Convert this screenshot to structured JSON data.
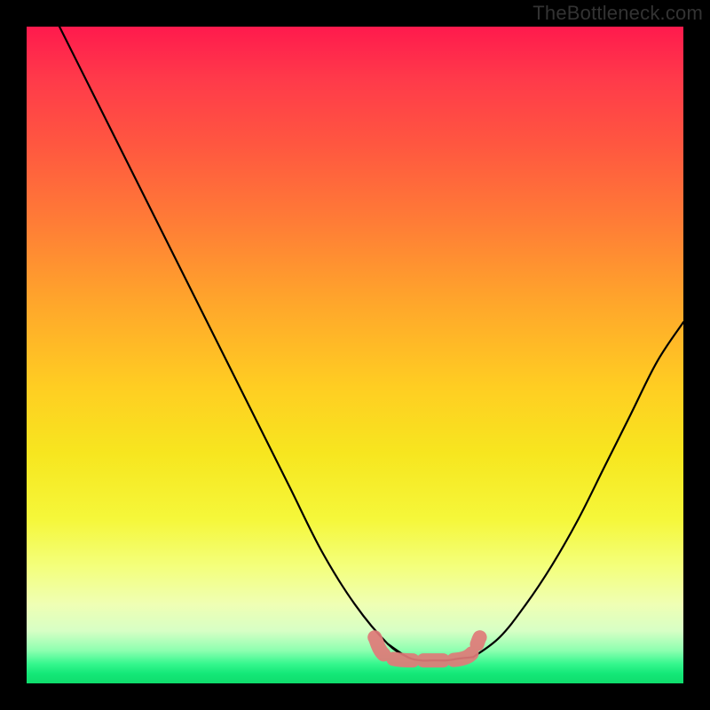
{
  "watermark": "TheBottleneck.com",
  "colors": {
    "top": "#ff1a4d",
    "mid": "#ffe433",
    "bottom": "#14e878",
    "curve": "#000000",
    "highlight": "#e07a78",
    "frame": "#000000"
  },
  "chart_data": {
    "type": "line",
    "title": "",
    "xlabel": "",
    "ylabel": "",
    "xlim": [
      0,
      100
    ],
    "ylim": [
      0,
      100
    ],
    "grid": false,
    "legend": false,
    "background_gradient": "vertical red-to-green (high=bad, low=good)",
    "description": "Bottleneck curve: one steep branch descends from top-left, a shallower branch rises toward top-right; they meet in a flat minimum near x≈55–68. The flat bottom is highlighted with a dashed salmon band.",
    "series": [
      {
        "name": "left-branch",
        "x": [
          5,
          10,
          15,
          20,
          25,
          30,
          35,
          40,
          45,
          50,
          55,
          58
        ],
        "y": [
          100,
          90,
          80,
          70,
          60,
          50,
          40,
          30,
          20,
          12,
          6,
          4
        ]
      },
      {
        "name": "right-branch",
        "x": [
          68,
          72,
          76,
          80,
          84,
          88,
          92,
          96,
          100
        ],
        "y": [
          4,
          7,
          12,
          18,
          25,
          33,
          41,
          49,
          55
        ]
      },
      {
        "name": "optimum-flat",
        "x": [
          55,
          58,
          60,
          62,
          64,
          66,
          68
        ],
        "y": [
          6,
          4,
          3.5,
          3.5,
          3.5,
          3.8,
          4
        ]
      }
    ],
    "annotations": [
      {
        "name": "optimal-range-highlight",
        "kind": "dashed-band",
        "x_from": 53,
        "x_to": 69,
        "y": 4,
        "color": "#e07a78"
      }
    ]
  }
}
